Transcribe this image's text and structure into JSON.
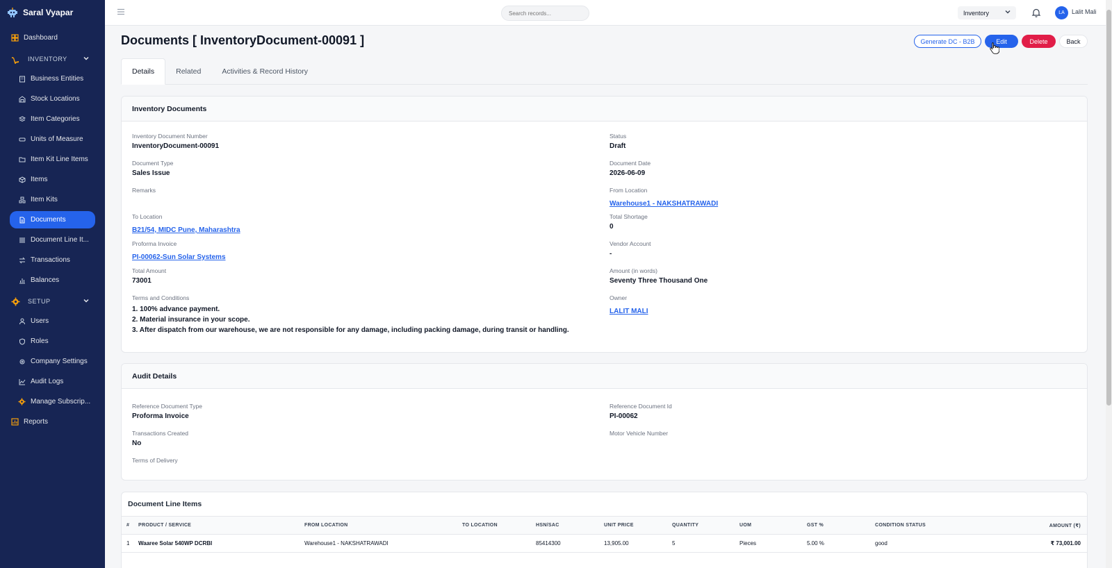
{
  "brand": {
    "name": "Saral Vyapar"
  },
  "sidebar": {
    "dashboard": "Dashboard",
    "inventory_section": "INVENTORY",
    "inventory_items": [
      {
        "label": "Business Entities",
        "icon": "building-icon"
      },
      {
        "label": "Stock Locations",
        "icon": "warehouse-icon"
      },
      {
        "label": "Item Categories",
        "icon": "layers-icon"
      },
      {
        "label": "Units of Measure",
        "icon": "ruler-icon"
      },
      {
        "label": "Item Kit Line Items",
        "icon": "folder-icon"
      },
      {
        "label": "Items",
        "icon": "box-icon"
      },
      {
        "label": "Item Kits",
        "icon": "kit-icon"
      },
      {
        "label": "Documents",
        "icon": "document-icon"
      },
      {
        "label": "Document Line It...",
        "icon": "list-icon"
      },
      {
        "label": "Transactions",
        "icon": "arrows-icon"
      },
      {
        "label": "Balances",
        "icon": "bar-chart-icon"
      }
    ],
    "setup_section": "SETUP",
    "setup_items": [
      {
        "label": "Users",
        "icon": "user-icon"
      },
      {
        "label": "Roles",
        "icon": "shield-icon"
      },
      {
        "label": "Company Settings",
        "icon": "gear-icon"
      },
      {
        "label": "Audit Logs",
        "icon": "line-chart-icon"
      },
      {
        "label": "Manage Subscrip...",
        "icon": "gear-icon"
      }
    ],
    "reports": "Reports",
    "active": "Documents"
  },
  "topbar": {
    "search_placeholder": "Search records...",
    "module": "Inventory",
    "avatar_initials": "LA",
    "username": "Lalit Mali"
  },
  "page": {
    "title": "Documents [ InventoryDocument-00091 ]",
    "buttons": {
      "dc": "Generate DC - B2B",
      "edit": "Edit",
      "delete": "Delete",
      "back": "Back"
    },
    "tabs": [
      "Details",
      "Related",
      "Activities & Record History"
    ]
  },
  "inventory_card": {
    "title": "Inventory Documents",
    "doc_number_label": "Inventory Document Number",
    "doc_number": "InventoryDocument-00091",
    "status_label": "Status",
    "status": "Draft",
    "doc_type_label": "Document Type",
    "doc_type": "Sales Issue",
    "doc_date_label": "Document Date",
    "doc_date": "2026-06-09",
    "remarks_label": "Remarks",
    "from_location_label": "From Location",
    "from_location": "Warehouse1 - NAKSHATRAWADI",
    "to_location_label": "To Location",
    "to_location": "B21/54, MIDC Pune, Maharashtra",
    "total_shortage_label": "Total Shortage",
    "total_shortage": "0",
    "proforma_label": "Proforma Invoice",
    "proforma": "PI-00062-Sun Solar Systems",
    "vendor_label": "Vendor Account",
    "vendor": "-",
    "total_amount_label": "Total Amount",
    "total_amount": "73001",
    "amount_words_label": "Amount (in words)",
    "amount_words": "Seventy Three Thousand One",
    "terms_label": "Terms and Conditions",
    "terms": [
      "1. 100% advance payment.",
      "2. Material insurance in your scope.",
      "3. After dispatch from our warehouse, we are not responsible for any damage, including packing damage, during transit or handling."
    ],
    "owner_label": "Owner",
    "owner": "LALIT MALI"
  },
  "audit_card": {
    "title": "Audit Details",
    "ref_type_label": "Reference Document Type",
    "ref_type": "Proforma Invoice",
    "ref_id_label": "Reference Document Id",
    "ref_id": "PI-00062",
    "tx_created_label": "Transactions Created",
    "tx_created": "No",
    "vehicle_label": "Motor Vehicle Number",
    "delivery_label": "Terms of Delivery"
  },
  "line_items": {
    "title": "Document Line Items",
    "columns": [
      "#",
      "PRODUCT / SERVICE",
      "FROM LOCATION",
      "TO LOCATION",
      "HSN/SAC",
      "UNIT PRICE",
      "QUANTITY",
      "UOM",
      "GST %",
      "CONDITION STATUS",
      "AMOUNT (₹)"
    ],
    "rows": [
      {
        "num": "1",
        "product": "Waaree Solar 540WP DCRBI",
        "from": "Warehouse1 - NAKSHATRAWADI",
        "to": "",
        "hsn": "85414300",
        "price": "13,905.00",
        "qty": "5",
        "uom": "Pieces",
        "gst": "5.00 %",
        "condition": "good",
        "amount": "₹ 73,001.00"
      }
    ]
  }
}
